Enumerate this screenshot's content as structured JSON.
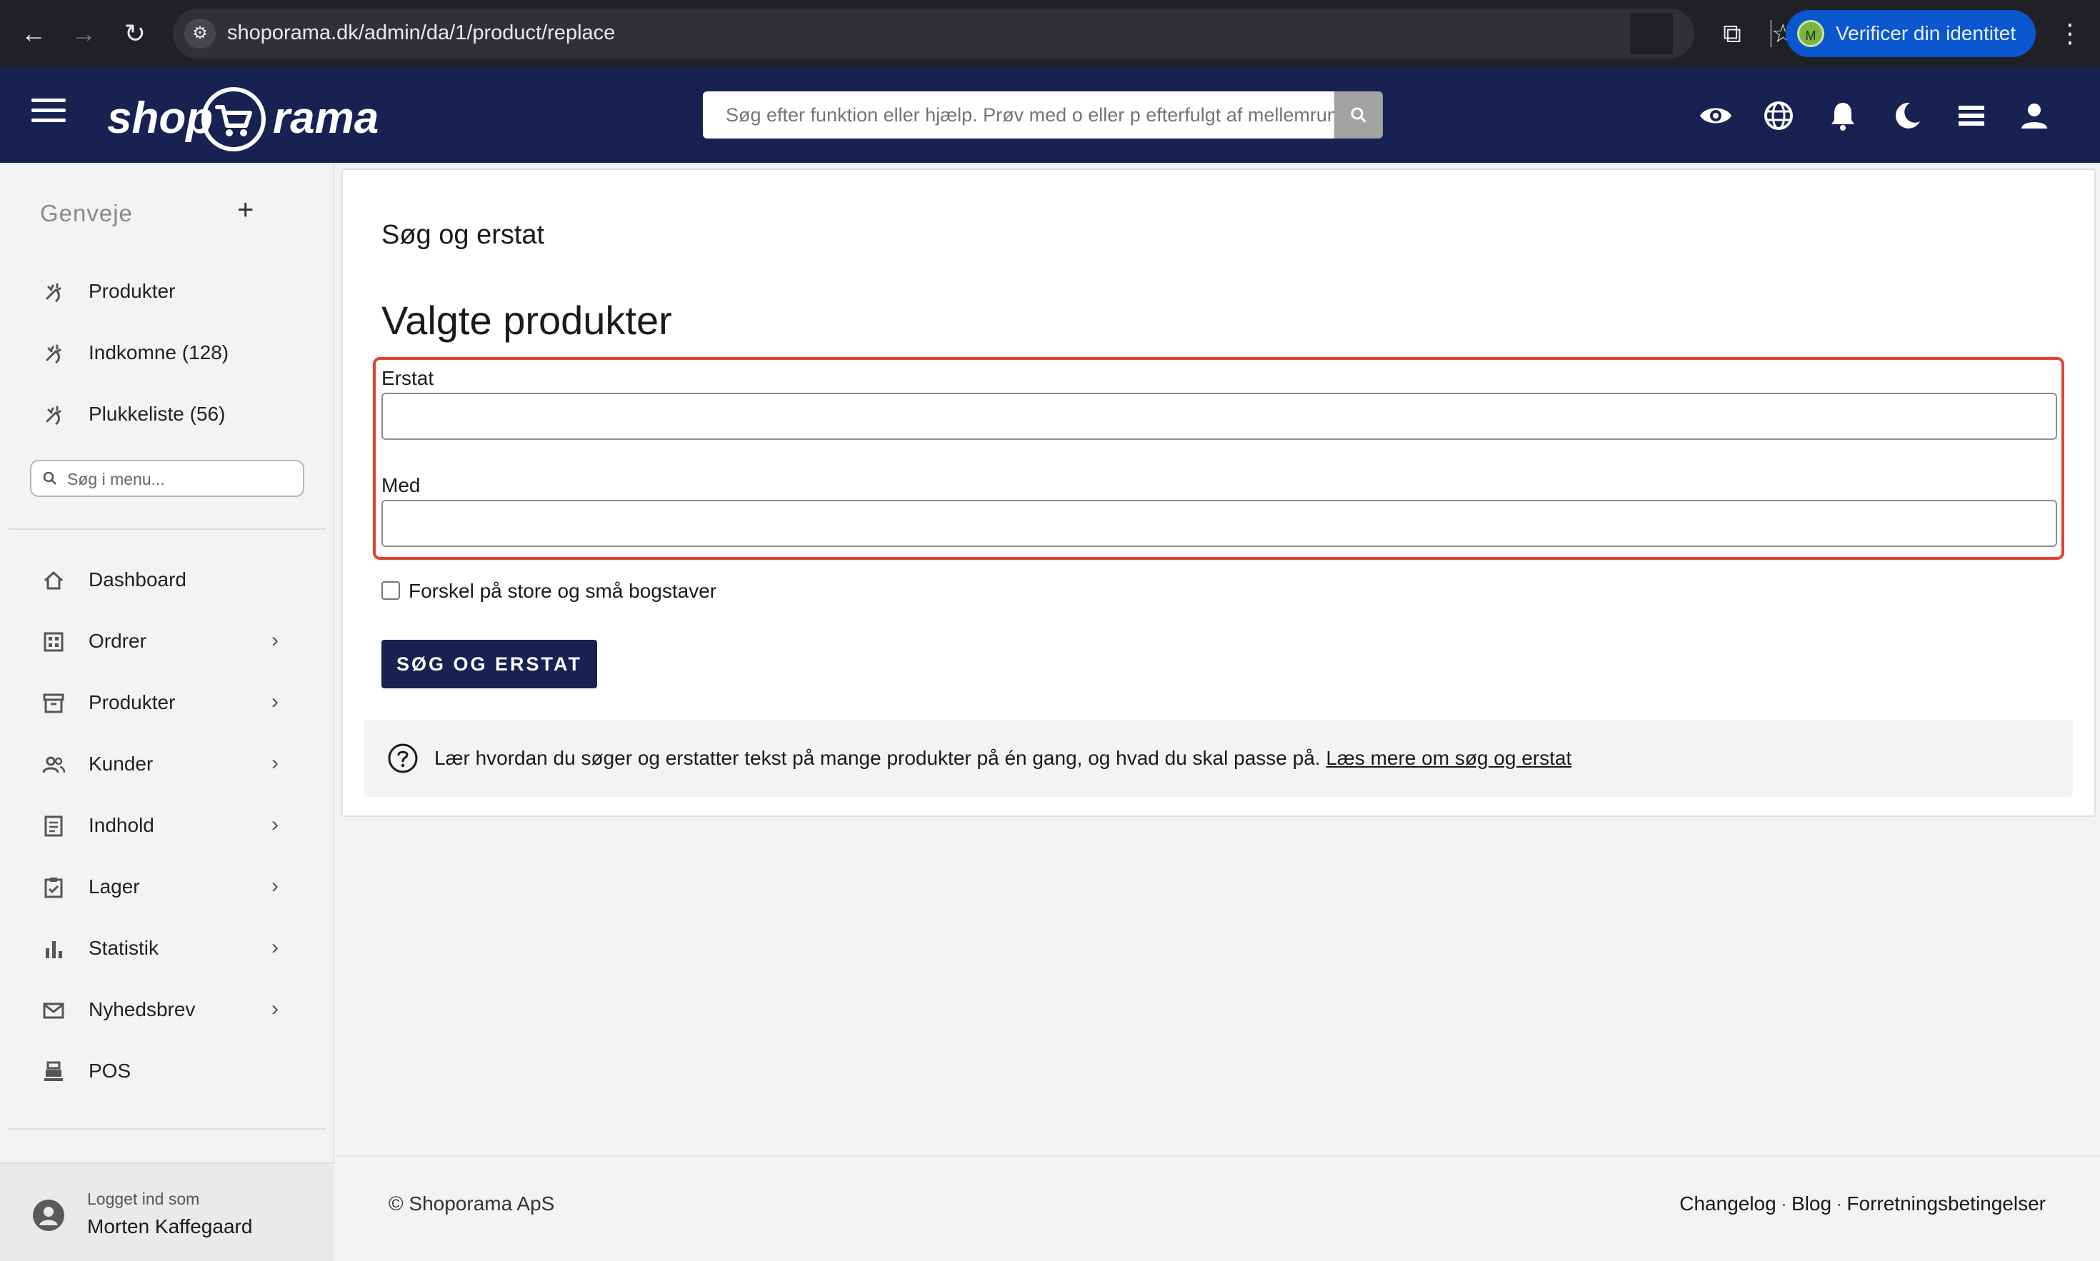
{
  "browser": {
    "url": "shoporama.dk/admin/da/1/product/replace",
    "profile_button": "Verificer din identitet",
    "profile_initial": "M"
  },
  "header": {
    "logo_left": "shop",
    "logo_right": "rama",
    "search_placeholder": "Søg efter funktion eller hjælp. Prøv med o eller p efterfulgt af mellemrum"
  },
  "sidebar": {
    "shortcuts_title": "Genveje",
    "shortcuts": [
      {
        "label": "Produkter"
      },
      {
        "label": "Indkomne (128)"
      },
      {
        "label": "Plukkeliste (56)"
      }
    ],
    "menu_search_placeholder": "Søg i menu...",
    "nav": [
      {
        "label": "Dashboard"
      },
      {
        "label": "Ordrer"
      },
      {
        "label": "Produkter"
      },
      {
        "label": "Kunder"
      },
      {
        "label": "Indhold"
      },
      {
        "label": "Lager"
      },
      {
        "label": "Statistik"
      },
      {
        "label": "Nyhedsbrev"
      },
      {
        "label": "POS"
      }
    ],
    "user": {
      "logged_in_label": "Logget ind som",
      "name": "Morten Kaffegaard"
    }
  },
  "main": {
    "page_title": "Søg og erstat",
    "section_title": "Valgte produkter",
    "replace_label": "Erstat",
    "replace_value": "",
    "with_label": "Med",
    "with_value": "",
    "case_sensitive_label": "Forskel på store og små bogstaver",
    "case_sensitive_checked": false,
    "submit_label": "SØG OG ERSTAT",
    "info_text": "Lær hvordan du søger og erstatter tekst på mange produkter på én gang, og hvad du skal passe på.",
    "info_link": "Læs mere om søg og erstat"
  },
  "footer": {
    "copyright": "© Shoporama ApS",
    "links": [
      "Changelog",
      "Blog",
      "Forretningsbetingelser"
    ],
    "separator": "·"
  },
  "colors": {
    "header_bg": "#172152",
    "primary_button": "#172152",
    "highlight_border": "#e0432f"
  }
}
